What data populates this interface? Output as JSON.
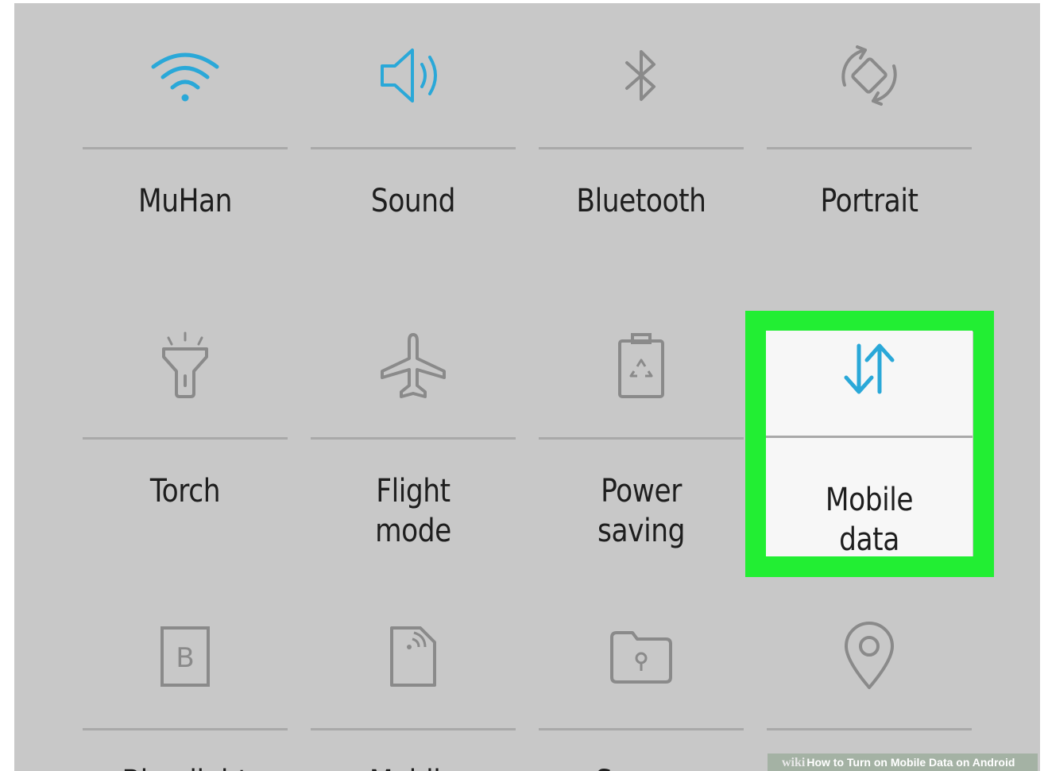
{
  "quick_settings": {
    "row1": [
      {
        "label": "MuHan",
        "icon": "wifi-icon",
        "active": true
      },
      {
        "label": "Sound",
        "icon": "speaker-icon",
        "active": true
      },
      {
        "label": "Bluetooth",
        "icon": "bluetooth-icon",
        "active": false
      },
      {
        "label": "Portrait",
        "icon": "rotate-icon",
        "active": false
      }
    ],
    "row2": [
      {
        "label": "Torch",
        "icon": "torch-icon",
        "active": false
      },
      {
        "label": "Flight mode",
        "icon": "airplane-icon",
        "active": false
      },
      {
        "label": "Power saving",
        "icon": "battery-recycle-icon",
        "active": false
      },
      {
        "label": "Mobile data",
        "icon": "data-arrows-icon",
        "active": true,
        "highlighted": true
      }
    ],
    "row3": [
      {
        "label": "Blue light",
        "icon": "blue-light-icon",
        "active": false
      },
      {
        "label": "Mobile",
        "icon": "mobile-hotspot-icon",
        "active": false
      },
      {
        "label": "Secure",
        "icon": "secure-folder-icon",
        "active": false
      },
      {
        "label": "",
        "icon": "location-icon",
        "active": false
      }
    ]
  },
  "watermark": {
    "brand": "wiki",
    "text": "How to Turn on Mobile Data on Android"
  },
  "colors": {
    "panel_bg": "#c8c8c8",
    "active_icon": "#2aa8d8",
    "inactive_icon": "#8a8a8a",
    "highlight": "#22ee33",
    "card_bg": "#f7f7f7"
  }
}
